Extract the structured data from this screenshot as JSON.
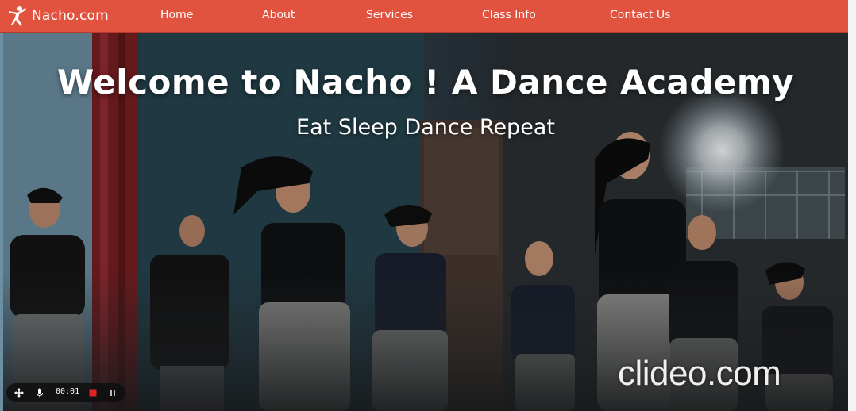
{
  "site": {
    "brand": "Nacho.com",
    "logo_icon": "dancer-icon"
  },
  "nav": {
    "items": [
      {
        "label": "Home"
      },
      {
        "label": "About"
      },
      {
        "label": "Services"
      },
      {
        "label": "Class Info"
      },
      {
        "label": "Contact Us"
      }
    ]
  },
  "hero": {
    "title": "Welcome to Nacho ! A Dance Academy",
    "subtitle": "Eat Sleep Dance Repeat"
  },
  "watermark": {
    "text": "clideo.com"
  },
  "recorder": {
    "time": "00:01",
    "icons": [
      "move-icon",
      "microphone-icon",
      "stop-icon",
      "pause-icon"
    ]
  },
  "colors": {
    "navbar": "#e2533f",
    "text": "#ffffff",
    "stop": "#e02424"
  }
}
